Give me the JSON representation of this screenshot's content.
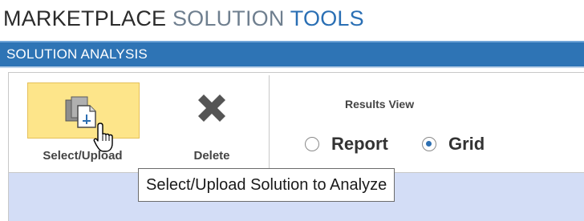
{
  "header": {
    "title_part1": "MARKETPLACE",
    "title_part2": "SOLUTION",
    "title_part3": "TOOLS",
    "colors": {
      "part1": "#2b2b2b",
      "part2": "#6f7f8f",
      "part3": "#2a6fb4"
    }
  },
  "section": {
    "title": "SOLUTION ANALYSIS",
    "color": "#2e74b5"
  },
  "toolbar": {
    "select_upload_label": "Select/Upload",
    "select_upload_icon": "file-upload-icon",
    "select_upload_highlight": "#fde58a",
    "delete_label": "Delete",
    "delete_icon": "x-close-icon"
  },
  "results_view": {
    "label": "Results View",
    "options": [
      {
        "label": "Report",
        "selected": false
      },
      {
        "label": "Grid",
        "selected": true
      }
    ]
  },
  "tooltip": {
    "text": "Select/Upload Solution to Analyze"
  },
  "cursor": {
    "icon": "hand-pointer-icon"
  },
  "content": {
    "background": "#d3ddf6"
  }
}
